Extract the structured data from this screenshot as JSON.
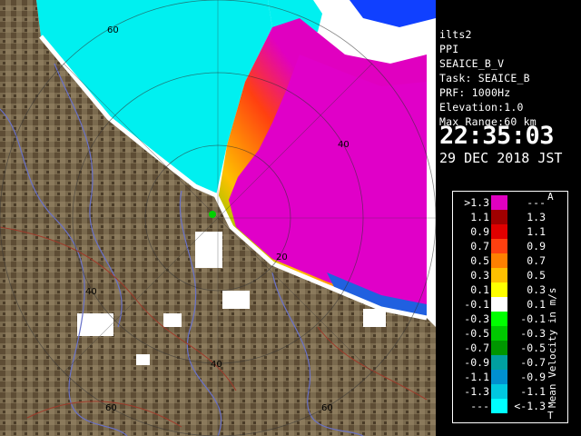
{
  "info": {
    "site": "ilts2",
    "mode": "PPI",
    "product": "SEAICE_B_V",
    "task": "Task: SEAICE_B",
    "prf": "PRF: 1000Hz",
    "elevation": "Elevation:1.0",
    "max_range": "Max Range:60 km",
    "time": "22:35:03",
    "date": "29 DEC 2018 JST"
  },
  "legend": {
    "title": "Mean Velocity in m/s",
    "top_marker": "A",
    "bottom_marker": "T",
    "rows": [
      {
        "lo": ">1.3",
        "hi": "---",
        "color": "#e000c0"
      },
      {
        "lo": "1.1",
        "hi": "1.3",
        "color": "#a00000"
      },
      {
        "lo": "0.9",
        "hi": "1.1",
        "color": "#e00000"
      },
      {
        "lo": "0.7",
        "hi": "0.9",
        "color": "#ff4010"
      },
      {
        "lo": "0.5",
        "hi": "0.7",
        "color": "#ff8000"
      },
      {
        "lo": "0.3",
        "hi": "0.5",
        "color": "#ffc000"
      },
      {
        "lo": "0.1",
        "hi": "0.3",
        "color": "#ffff00"
      },
      {
        "lo": "-0.1",
        "hi": "0.1",
        "color": "#ffffff"
      },
      {
        "lo": "-0.3",
        "hi": "-0.1",
        "color": "#00ff00"
      },
      {
        "lo": "-0.5",
        "hi": "-0.3",
        "color": "#00c800"
      },
      {
        "lo": "-0.7",
        "hi": "-0.5",
        "color": "#009600"
      },
      {
        "lo": "-0.9",
        "hi": "-0.7",
        "color": "#00a0a0"
      },
      {
        "lo": "-1.1",
        "hi": "-0.9",
        "color": "#0090d0"
      },
      {
        "lo": "-1.3",
        "hi": "-1.1",
        "color": "#00c8e0"
      },
      {
        "lo": "---",
        "hi": "<-1.3",
        "color": "#00ffff"
      }
    ]
  },
  "range_labels": {
    "r60_north": "60",
    "r40_east": "40",
    "r40_west": "40",
    "r40_south": "40",
    "r60_south": "60",
    "r60_southeast": "60",
    "r20": "20"
  },
  "colors": {
    "land": "#7a6a4e",
    "land_dark": "#4e3f2a",
    "sea_approach": "#00f0f0",
    "sea_recede": "#e000c8",
    "background": "#ffffff",
    "rivers": "#6a72c8",
    "roads": "#a03a2a"
  }
}
